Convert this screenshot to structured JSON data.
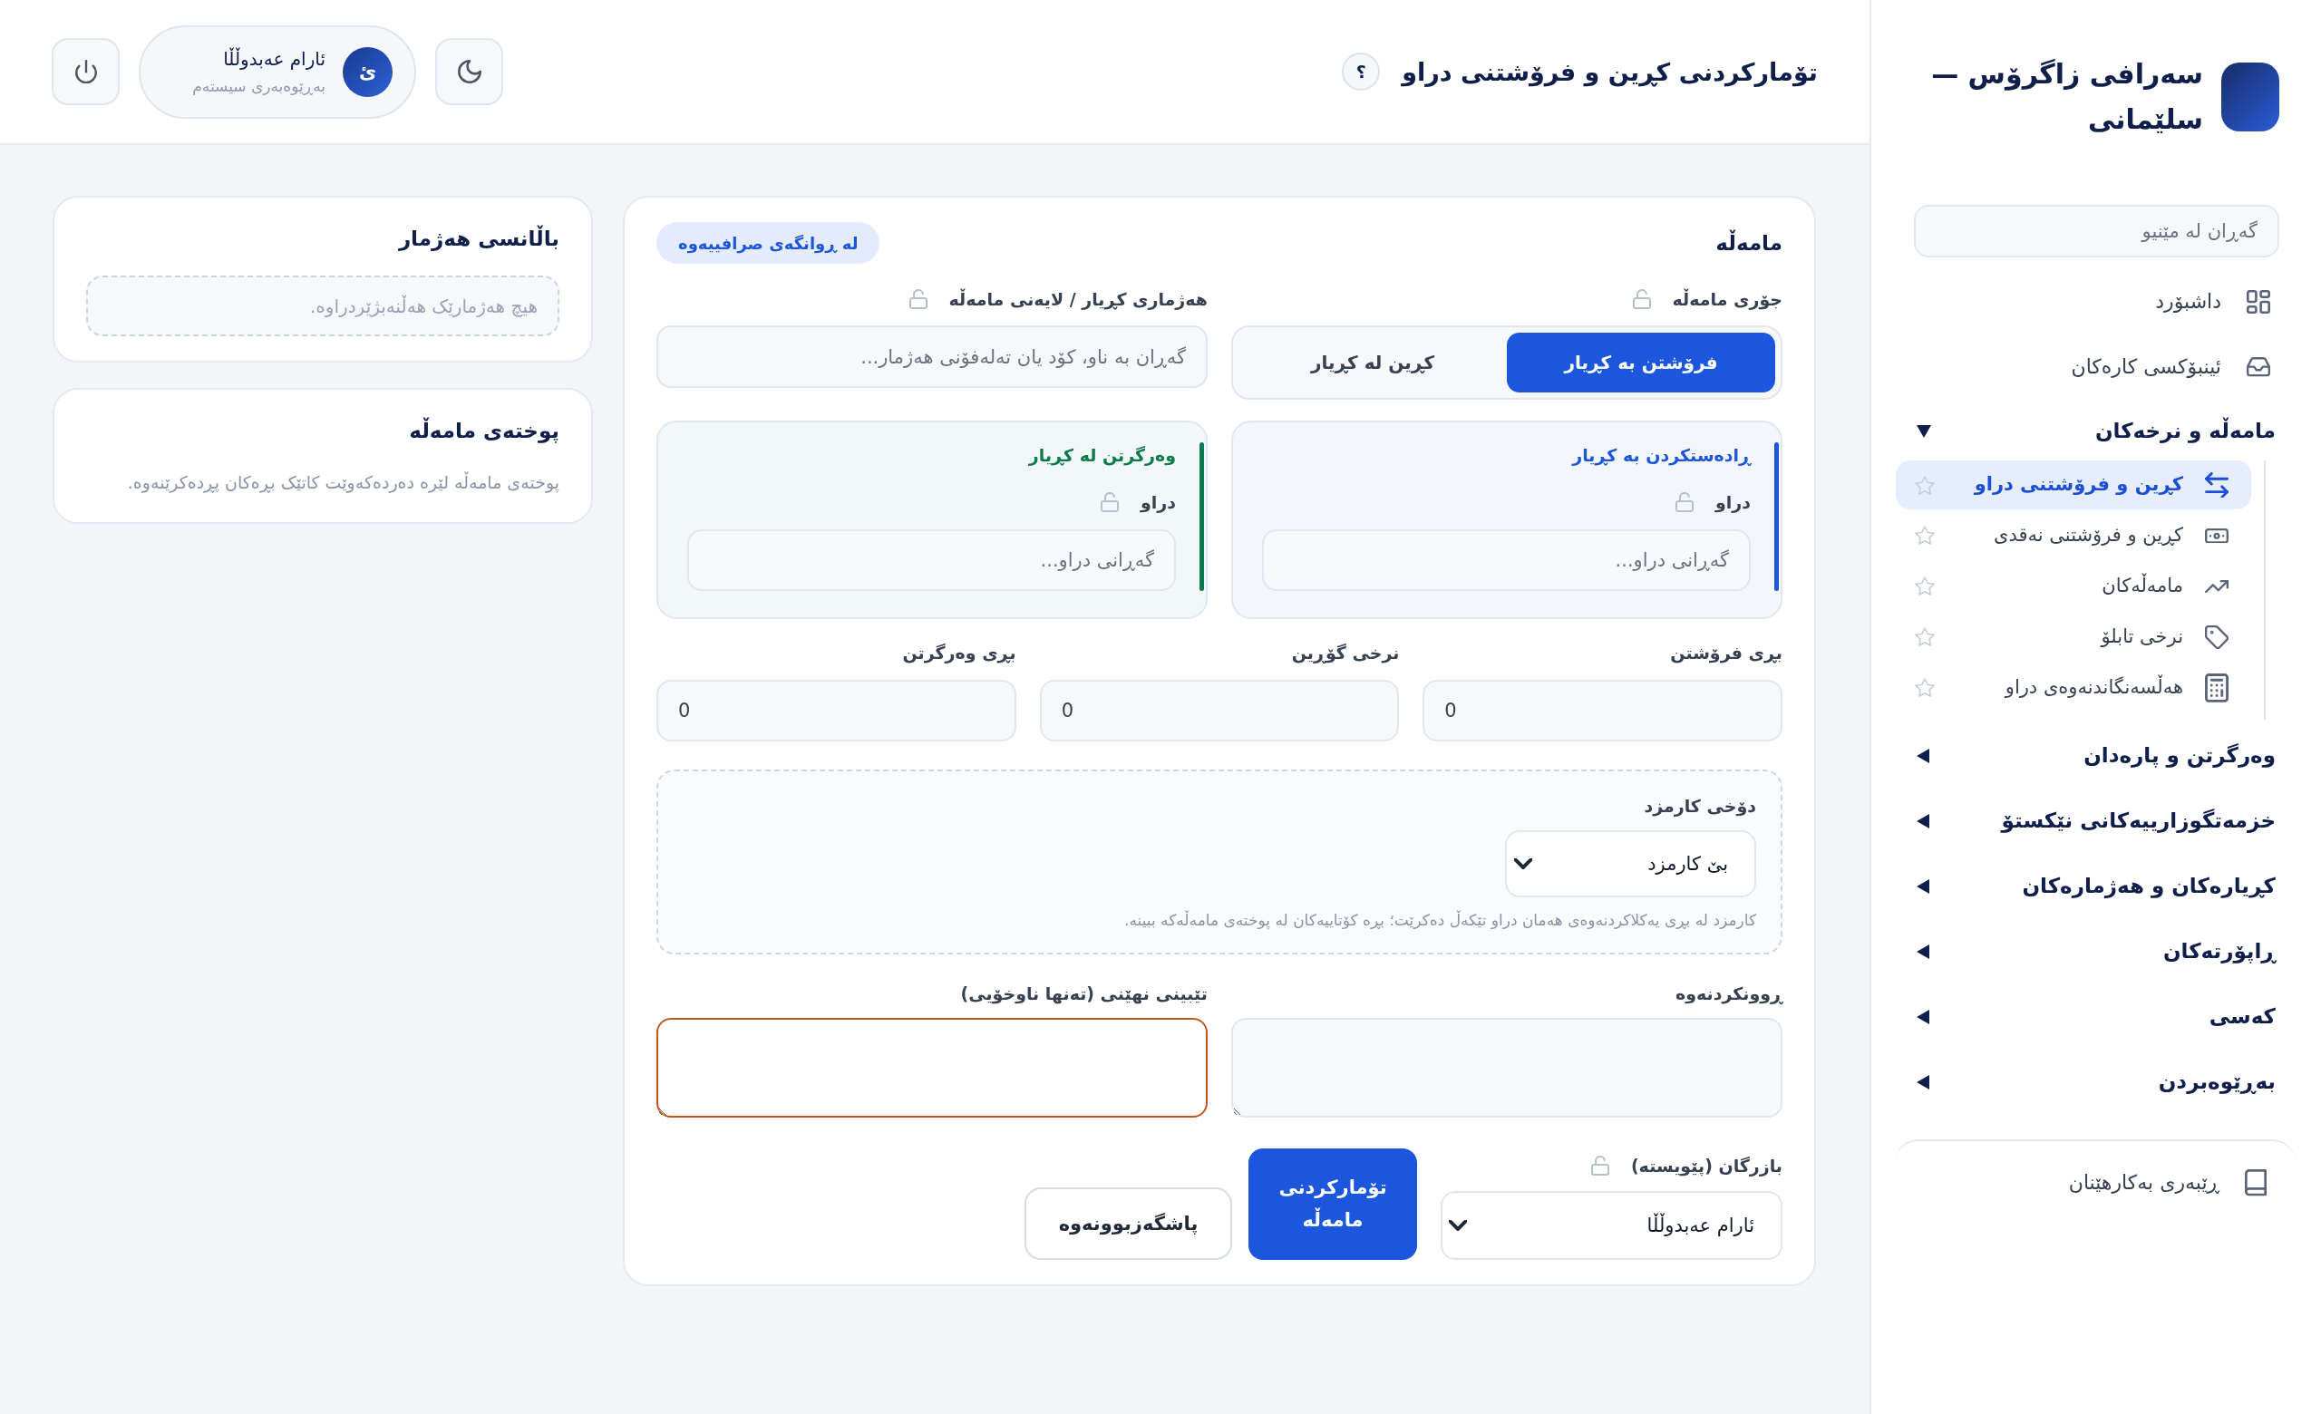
{
  "sidebar": {
    "brand": {
      "title": "سەرافی زاگرۆس — سلێمانی"
    },
    "search": {
      "placeholder": "گەڕان لە مێنیو"
    },
    "nav": [
      {
        "kind": "link",
        "label": "داشبۆرد"
      },
      {
        "kind": "link",
        "label": "ئینبۆکسی کارەکان"
      },
      {
        "kind": "group",
        "label": "مامەڵە و نرخەکان",
        "expanded": true,
        "children": [
          {
            "label": "کڕین و فرۆشتنی دراو",
            "selected": true,
            "starred": false
          },
          {
            "label": "کڕین و فرۆشتنی نەقدی",
            "selected": false,
            "starred": false
          },
          {
            "label": "مامەڵەکان",
            "selected": false,
            "starred": false
          },
          {
            "label": "نرخی تابلۆ",
            "selected": false,
            "starred": false
          },
          {
            "label": "هەڵسەنگاندنەوەی دراو",
            "selected": false,
            "starred": false
          }
        ]
      },
      {
        "kind": "group",
        "label": "وەرگرتن و پارەدان",
        "expanded": false
      },
      {
        "kind": "group",
        "label": "خزمەتگوزارییەکانی نێکستۆ",
        "expanded": false
      },
      {
        "kind": "group",
        "label": "کڕیارەکان و هەژمارەکان",
        "expanded": false
      },
      {
        "kind": "group",
        "label": "ڕاپۆرتەکان",
        "expanded": false
      },
      {
        "kind": "group",
        "label": "کەسی",
        "expanded": false
      },
      {
        "kind": "group",
        "label": "بەڕێوەبردن",
        "expanded": false
      }
    ],
    "footer_items": [
      {
        "label": "ڕێبەری بەکارهێنان"
      }
    ]
  },
  "header": {
    "title": "تۆمارکردنی کڕین و فرۆشتنی دراو",
    "help_label": "؟",
    "user": {
      "initial": "ئ",
      "name": "ئارام عەبدوڵڵا",
      "role": "بەڕێوەبەری سیستەم"
    }
  },
  "transaction_form": {
    "title": "مامەڵە",
    "badge": "لە ڕوانگەی صرافییەوە",
    "type_field": {
      "label": "جۆری مامەڵە",
      "locked": false,
      "options": [
        {
          "label": "فرۆشتن بە کڕیار",
          "selected": true
        },
        {
          "label": "کڕین لە کڕیار",
          "selected": false
        }
      ]
    },
    "account_field": {
      "label": "هەژماری کڕیار / لایەنی مامەڵە",
      "locked": false,
      "placeholder": "گەڕان بە ناو، کۆد یان تەلەفۆنی هەژمار..."
    },
    "legs": [
      {
        "title": "ڕادەستکردن بە کڕیار",
        "color": "#1d56d8",
        "currency_label": "دراو",
        "locked": false,
        "placeholder": "گەڕانی دراو..."
      },
      {
        "title": "وەرگرتن لە کڕیار",
        "color": "#0b7a4c",
        "currency_label": "دراو",
        "locked": false,
        "placeholder": "گەڕانی دراو..."
      }
    ],
    "amounts": [
      {
        "label": "بڕی فرۆشتن",
        "value": "0"
      },
      {
        "label": "نرخی گۆڕین",
        "value": "0"
      },
      {
        "label": "بڕی وەرگرتن",
        "value": "0"
      }
    ],
    "fee": {
      "label": "دۆخی کارمزد",
      "value": "بێ کارمزد",
      "hint": "کارمزد لە بڕی یەکلاکردنەوەی هەمان دراو تێکەڵ دەکرێت؛ بڕە کۆتاییەکان لە پوختەی مامەڵەکە ببینە."
    },
    "text_areas": [
      {
        "label": "ڕوونکردنەوە",
        "focused": false
      },
      {
        "label": "تێبینی نهێنی (تەنها ناوخۆیی)",
        "focused": true
      }
    ],
    "merchant": {
      "label": "بازرگان (پێویستە)",
      "locked": false,
      "value": "ئارام عەبدوڵڵا"
    },
    "actions": [
      {
        "kind": "primary",
        "label": "تۆمارکردنی مامەڵە"
      },
      {
        "kind": "secondary",
        "label": "پاشگەزبوونەوە"
      }
    ]
  },
  "balance_card": {
    "title": "باڵانسی هەژمار",
    "empty_text": "هیچ هەژمارێک هەڵنەبژێردراوە."
  },
  "summary_card": {
    "title": "پوختەی مامەڵە",
    "text": "پوختەی مامەڵە لێرە دەردەکەوێت کاتێک بڕەکان پڕدەکرێنەوە."
  }
}
